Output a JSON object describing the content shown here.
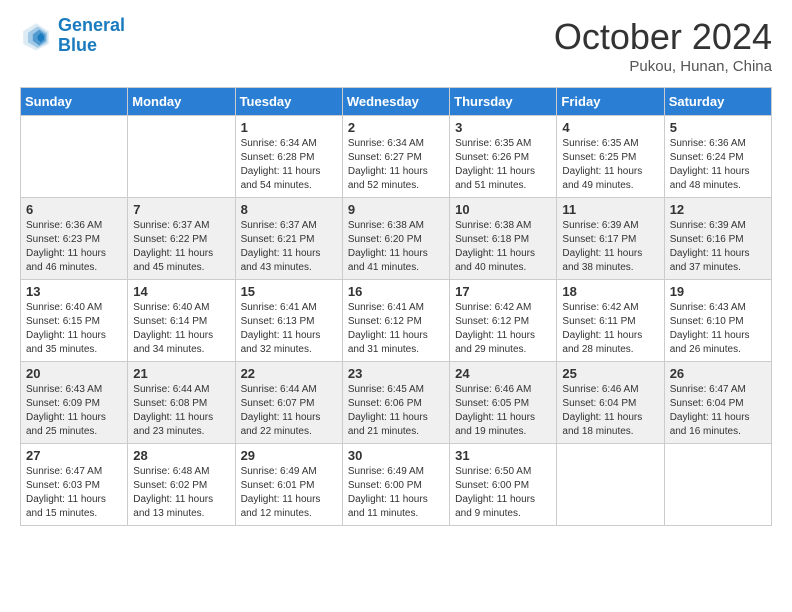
{
  "logo": {
    "line1": "General",
    "line2": "Blue"
  },
  "title": "October 2024",
  "subtitle": "Pukou, Hunan, China",
  "weekdays": [
    "Sunday",
    "Monday",
    "Tuesday",
    "Wednesday",
    "Thursday",
    "Friday",
    "Saturday"
  ],
  "weeks": [
    [
      {
        "day": "",
        "info": ""
      },
      {
        "day": "",
        "info": ""
      },
      {
        "day": "1",
        "info": "Sunrise: 6:34 AM\nSunset: 6:28 PM\nDaylight: 11 hours and 54 minutes."
      },
      {
        "day": "2",
        "info": "Sunrise: 6:34 AM\nSunset: 6:27 PM\nDaylight: 11 hours and 52 minutes."
      },
      {
        "day": "3",
        "info": "Sunrise: 6:35 AM\nSunset: 6:26 PM\nDaylight: 11 hours and 51 minutes."
      },
      {
        "day": "4",
        "info": "Sunrise: 6:35 AM\nSunset: 6:25 PM\nDaylight: 11 hours and 49 minutes."
      },
      {
        "day": "5",
        "info": "Sunrise: 6:36 AM\nSunset: 6:24 PM\nDaylight: 11 hours and 48 minutes."
      }
    ],
    [
      {
        "day": "6",
        "info": "Sunrise: 6:36 AM\nSunset: 6:23 PM\nDaylight: 11 hours and 46 minutes."
      },
      {
        "day": "7",
        "info": "Sunrise: 6:37 AM\nSunset: 6:22 PM\nDaylight: 11 hours and 45 minutes."
      },
      {
        "day": "8",
        "info": "Sunrise: 6:37 AM\nSunset: 6:21 PM\nDaylight: 11 hours and 43 minutes."
      },
      {
        "day": "9",
        "info": "Sunrise: 6:38 AM\nSunset: 6:20 PM\nDaylight: 11 hours and 41 minutes."
      },
      {
        "day": "10",
        "info": "Sunrise: 6:38 AM\nSunset: 6:18 PM\nDaylight: 11 hours and 40 minutes."
      },
      {
        "day": "11",
        "info": "Sunrise: 6:39 AM\nSunset: 6:17 PM\nDaylight: 11 hours and 38 minutes."
      },
      {
        "day": "12",
        "info": "Sunrise: 6:39 AM\nSunset: 6:16 PM\nDaylight: 11 hours and 37 minutes."
      }
    ],
    [
      {
        "day": "13",
        "info": "Sunrise: 6:40 AM\nSunset: 6:15 PM\nDaylight: 11 hours and 35 minutes."
      },
      {
        "day": "14",
        "info": "Sunrise: 6:40 AM\nSunset: 6:14 PM\nDaylight: 11 hours and 34 minutes."
      },
      {
        "day": "15",
        "info": "Sunrise: 6:41 AM\nSunset: 6:13 PM\nDaylight: 11 hours and 32 minutes."
      },
      {
        "day": "16",
        "info": "Sunrise: 6:41 AM\nSunset: 6:12 PM\nDaylight: 11 hours and 31 minutes."
      },
      {
        "day": "17",
        "info": "Sunrise: 6:42 AM\nSunset: 6:12 PM\nDaylight: 11 hours and 29 minutes."
      },
      {
        "day": "18",
        "info": "Sunrise: 6:42 AM\nSunset: 6:11 PM\nDaylight: 11 hours and 28 minutes."
      },
      {
        "day": "19",
        "info": "Sunrise: 6:43 AM\nSunset: 6:10 PM\nDaylight: 11 hours and 26 minutes."
      }
    ],
    [
      {
        "day": "20",
        "info": "Sunrise: 6:43 AM\nSunset: 6:09 PM\nDaylight: 11 hours and 25 minutes."
      },
      {
        "day": "21",
        "info": "Sunrise: 6:44 AM\nSunset: 6:08 PM\nDaylight: 11 hours and 23 minutes."
      },
      {
        "day": "22",
        "info": "Sunrise: 6:44 AM\nSunset: 6:07 PM\nDaylight: 11 hours and 22 minutes."
      },
      {
        "day": "23",
        "info": "Sunrise: 6:45 AM\nSunset: 6:06 PM\nDaylight: 11 hours and 21 minutes."
      },
      {
        "day": "24",
        "info": "Sunrise: 6:46 AM\nSunset: 6:05 PM\nDaylight: 11 hours and 19 minutes."
      },
      {
        "day": "25",
        "info": "Sunrise: 6:46 AM\nSunset: 6:04 PM\nDaylight: 11 hours and 18 minutes."
      },
      {
        "day": "26",
        "info": "Sunrise: 6:47 AM\nSunset: 6:04 PM\nDaylight: 11 hours and 16 minutes."
      }
    ],
    [
      {
        "day": "27",
        "info": "Sunrise: 6:47 AM\nSunset: 6:03 PM\nDaylight: 11 hours and 15 minutes."
      },
      {
        "day": "28",
        "info": "Sunrise: 6:48 AM\nSunset: 6:02 PM\nDaylight: 11 hours and 13 minutes."
      },
      {
        "day": "29",
        "info": "Sunrise: 6:49 AM\nSunset: 6:01 PM\nDaylight: 11 hours and 12 minutes."
      },
      {
        "day": "30",
        "info": "Sunrise: 6:49 AM\nSunset: 6:00 PM\nDaylight: 11 hours and 11 minutes."
      },
      {
        "day": "31",
        "info": "Sunrise: 6:50 AM\nSunset: 6:00 PM\nDaylight: 11 hours and 9 minutes."
      },
      {
        "day": "",
        "info": ""
      },
      {
        "day": "",
        "info": ""
      }
    ]
  ]
}
